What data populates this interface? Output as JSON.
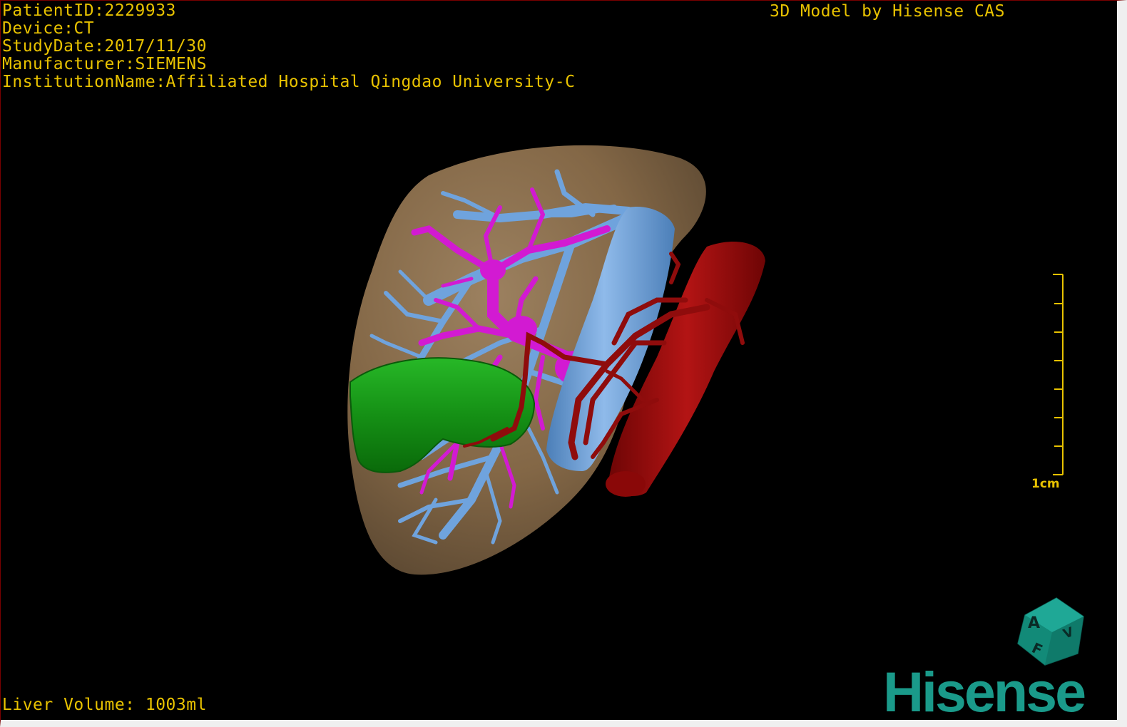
{
  "overlay": {
    "patient_id": "PatientID:2229933",
    "device": "Device:CT",
    "study_date": "StudyDate:2017/11/30",
    "manufacturer": "Manufacturer:SIEMENS",
    "institution": "InstitutionName:Affiliated Hospital Qingdao University-C",
    "title": "3D Model by Hisense CAS",
    "liver_volume": "Liver Volume: 1003ml"
  },
  "scale_bar": {
    "label": "1cm"
  },
  "orientation_cube": {
    "face_a": "A",
    "face_f": "F",
    "face_v": "V"
  },
  "brand": {
    "logo_text": "Hisense"
  },
  "colors": {
    "overlay_text": "#e8c200",
    "liver": "#8a6f4c",
    "portal_vein": "#d21ad2",
    "hepatic_vein": "#6fa3dd",
    "artery_aorta": "#9a0a0a",
    "tumor": "#1aa51a",
    "brand": "#1a9a8a"
  }
}
